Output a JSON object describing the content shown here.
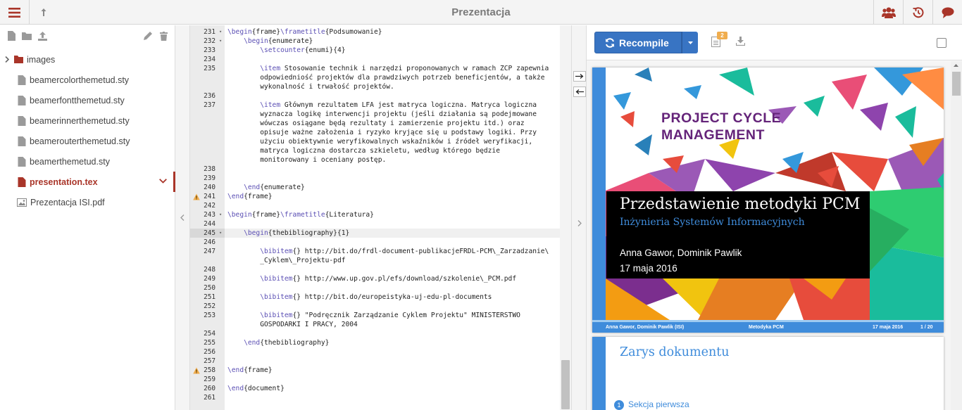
{
  "app": {
    "title": "Prezentacja"
  },
  "file_tree": {
    "items": [
      {
        "label": "images",
        "type": "folder"
      },
      {
        "label": "beamercolorthemetud.sty",
        "type": "file"
      },
      {
        "label": "beamerfontthemetud.sty",
        "type": "file"
      },
      {
        "label": "beamerinnerthemetud.sty",
        "type": "file"
      },
      {
        "label": "beamerouterthemetud.sty",
        "type": "file"
      },
      {
        "label": "beamerthemetud.sty",
        "type": "file"
      },
      {
        "label": "presentation.tex",
        "type": "file",
        "active": true
      },
      {
        "label": "Prezentacja ISI.pdf",
        "type": "pdf"
      }
    ]
  },
  "editor": {
    "line_numbers": [
      "231",
      "232",
      "233",
      "234",
      "235",
      "",
      "",
      "236",
      "237",
      "",
      "",
      "",
      "",
      "",
      "",
      "238",
      "239",
      "240",
      "241",
      "242",
      "243",
      "244",
      "245",
      "246",
      "247",
      "",
      "248",
      "249",
      "250",
      "251",
      "252",
      "253",
      "",
      "254",
      "255",
      "256",
      "257",
      "258",
      "259",
      "260",
      "261"
    ],
    "lines": [
      "\\begin{frame}\\frametitle{Podsumowanie}",
      "    \\begin{enumerate}",
      "        \\setcounter{enumi}{4}",
      "",
      "        \\item Stosowanie technik i narzędzi proponowanych w ramach ZCP zapewnia",
      "        odpowiedniość projektów dla prawdziwych potrzeb beneficjentów, a także",
      "        wykonalność i trwałość projektów.",
      "",
      "        \\item Głównym rezultatem LFA jest matryca logiczna. Matryca logiczna",
      "        wyznacza logikę interwencji projektu (jeśli działania są podejmowane",
      "        wówczas osiągane będą rezultaty i zamierzenie projektu itd.) oraz",
      "        opisuje ważne założenia i ryzyko kryjące się u podstawy logiki. Przy",
      "        użyciu obiektywnie weryfikowalnych wskaźników i źródeł weryfikacji,",
      "        matryca logiczna dostarcza szkieletu, według którego będzie",
      "        monitorowany i oceniany postęp.",
      "",
      "",
      "    \\end{enumerate}",
      "\\end{frame}",
      "",
      "\\begin{frame}\\frametitle{Literatura}",
      "",
      "    \\begin{thebibliography}{1}",
      "",
      "        \\bibitem{} http://bit.do/frdl-document-publikacjeFRDL-PCM\\_Zarzadzanie\\",
      "        _Cyklem\\_Projektu-pdf",
      "",
      "        \\bibitem{} http://www.up.gov.pl/efs/download/szkolenie\\_PCM.pdf",
      "",
      "        \\bibitem{} http://bit.do/europeistyka-uj-edu-pl-documents",
      "",
      "        \\bibitem{} \"Podręcznik Zarządzanie Cyklem Projektu\" MINISTERSTWO",
      "        GOSPODARKI I PRACY, 2004",
      "",
      "    \\end{thebibliography}",
      "",
      "",
      "\\end{frame}",
      "",
      "\\end{document}",
      ""
    ]
  },
  "pdf": {
    "recompile_label": "Recompile",
    "log_badge": "2",
    "slide1": {
      "logo_line1": "PROJECT CYCLE",
      "logo_line2": "MANAGEMENT",
      "title": "Przedstawienie metodyki PCM",
      "subtitle": "Inżynieria Systemów Informacyjnych",
      "authors": "Anna Gawor, Dominik Pawlik",
      "date": "17 maja 2016",
      "footer_authors": "Anna Gawor, Dominik Pawlik  (ISI)",
      "footer_title": "Metodyka PCM",
      "footer_date": "17 maja 2016",
      "footer_page": "1 / 20"
    },
    "slide2": {
      "title": "Zarys dokumentu",
      "item_num": "1",
      "item": "Sekcja pierwsza"
    }
  },
  "colors": {
    "accent": "#a93529",
    "recompile": "#3874c3",
    "slide_blue": "#3f8cdb",
    "logo_purple": "#642379"
  }
}
